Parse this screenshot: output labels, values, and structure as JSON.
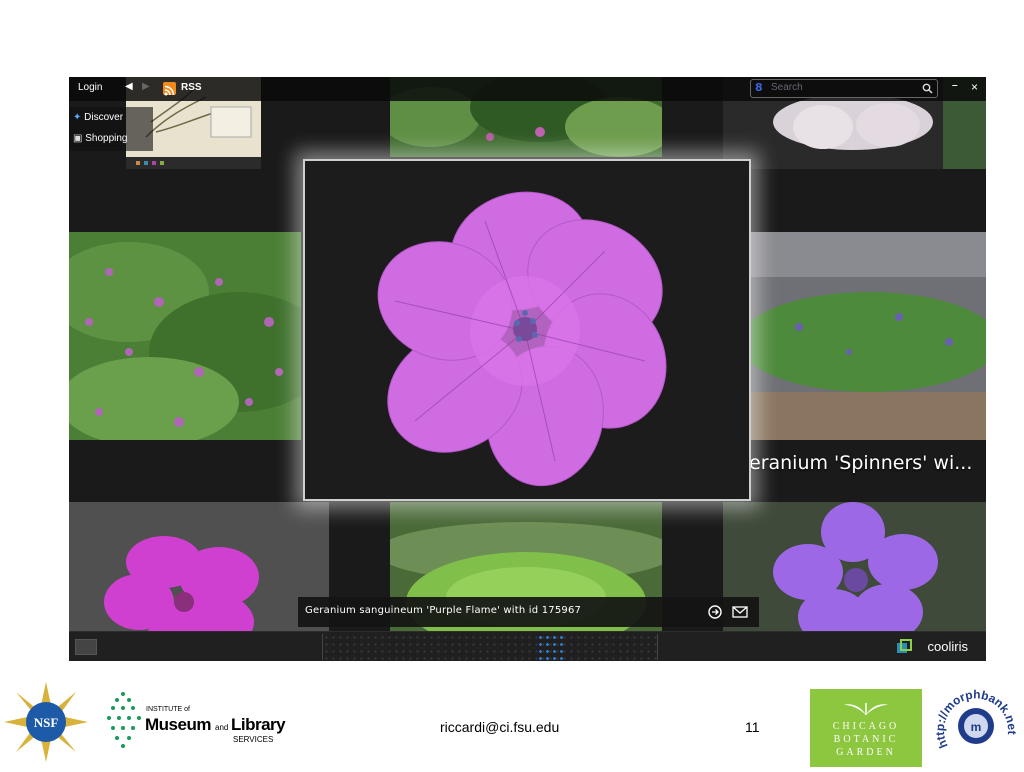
{
  "toolbar": {
    "login_label": "Login",
    "rss_label": "RSS",
    "search_placeholder": "Search",
    "minimize_label": "–",
    "close_label": "×"
  },
  "sidebar": {
    "items": [
      {
        "label": "Discover",
        "icon": "discover-icon"
      },
      {
        "label": "Shopping",
        "icon": "shopping-bag-icon"
      }
    ]
  },
  "wall": {
    "adjacent_caption": "eranium 'Spinners' wi..."
  },
  "infobar": {
    "caption": "Geranium sanguineum 'Purple Flame' with id 175967"
  },
  "bottombar": {
    "brand": "cooliris"
  },
  "footer": {
    "email": "riccardi@ci.fsu.edu",
    "page_number": "11",
    "logos": {
      "nsf": "NSF",
      "imls_line1": "INSTITUTE of",
      "imls_museum": "Museum",
      "imls_and": "and",
      "imls_library": "Library",
      "imls_services": "SERVICES",
      "cbg_line1": "CHICAGO",
      "cbg_line2": "BOTANIC",
      "cbg_line3": "GARDEN",
      "morphbank": "http://morphbank.net"
    }
  },
  "colors": {
    "app_background": "#1a1a1a",
    "flower_magenta": "#d36be0",
    "flower_violet": "#9b6be8",
    "foliage_green": "#4f8a3a",
    "garden_green": "#8dc63f",
    "rss_orange": "#f08a1c"
  }
}
